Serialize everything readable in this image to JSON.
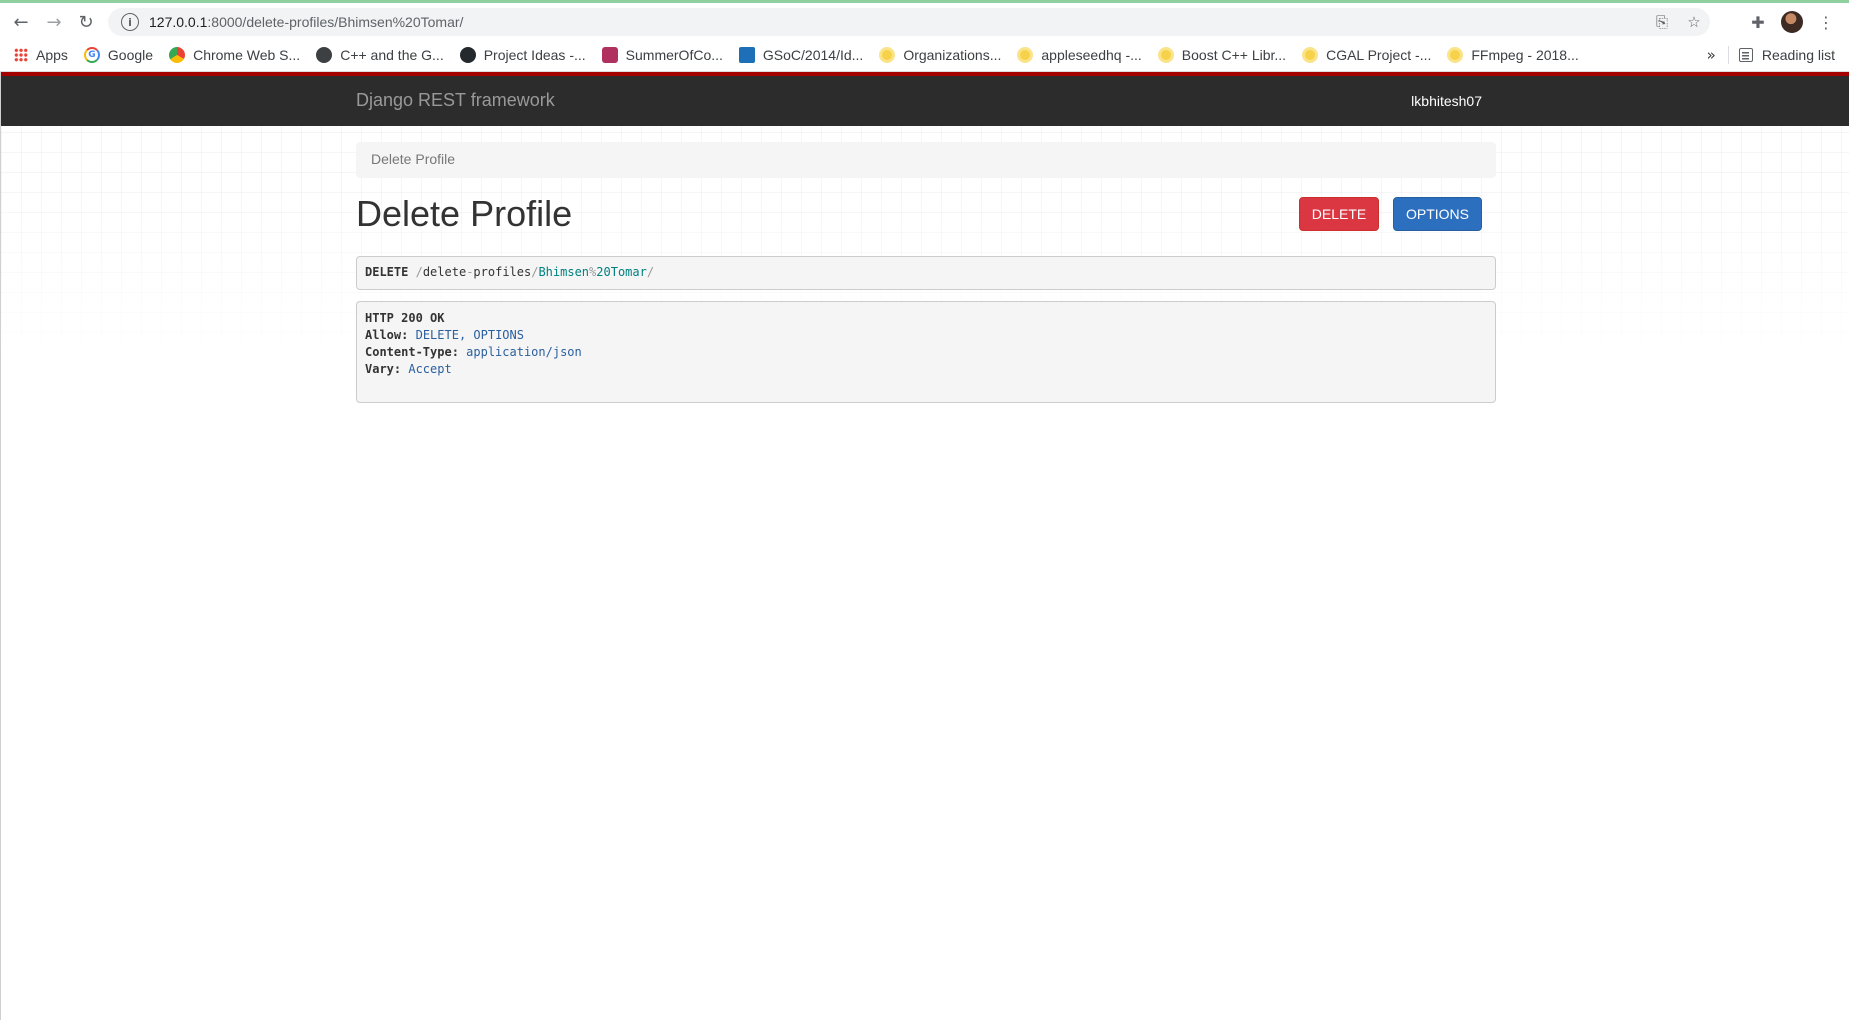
{
  "browser": {
    "url_host": "127.0.0.1",
    "url_rest": ":8000/delete-profiles/Bhimsen%20Tomar/",
    "bookmarks": [
      {
        "label": "Apps",
        "icon": "apps-grid-icon"
      },
      {
        "label": "Google",
        "icon": "google-icon"
      },
      {
        "label": "Chrome Web S...",
        "icon": "chrome-web-store-icon"
      },
      {
        "label": "C++ and the G...",
        "icon": "cpp-site-icon"
      },
      {
        "label": "Project Ideas -...",
        "icon": "github-icon"
      },
      {
        "label": "SummerOfCo...",
        "icon": "summer-of-code-icon"
      },
      {
        "label": "GSoC/2014/Id...",
        "icon": "kde-icon"
      },
      {
        "label": "Organizations...",
        "icon": "gsoc-sun-icon"
      },
      {
        "label": "appleseedhq -...",
        "icon": "gsoc-sun-icon"
      },
      {
        "label": "Boost C++ Libr...",
        "icon": "gsoc-sun-icon"
      },
      {
        "label": "CGAL Project -...",
        "icon": "gsoc-sun-icon"
      },
      {
        "label": "FFmpeg - 2018...",
        "icon": "gsoc-sun-icon"
      }
    ],
    "more_label": "»",
    "reading_list_label": "Reading list"
  },
  "app": {
    "brand": "Django REST framework",
    "username": "lkbhitesh07",
    "breadcrumb": "Delete Profile",
    "title": "Delete Profile",
    "buttons": {
      "delete": "DELETE",
      "options": "OPTIONS"
    },
    "request": {
      "method": "DELETE",
      "path_segment_1": "delete",
      "path_dash": "-",
      "path_segment_1b": "profiles",
      "path_segment_2": "Bhimsen",
      "path_pct": "%",
      "path_segment_3": "20Tomar"
    },
    "response": {
      "status": "HTTP 200 OK",
      "headers": [
        {
          "key": "Allow:",
          "value": "DELETE, OPTIONS"
        },
        {
          "key": "Content-Type:",
          "value": "application/json"
        },
        {
          "key": "Vary:",
          "value": "Accept"
        }
      ]
    }
  },
  "colors": {
    "navbar": "#2c2c2c",
    "navbar_accent": "#a30000",
    "delete_button": "#da3743",
    "options_button": "#2c6fbf"
  }
}
